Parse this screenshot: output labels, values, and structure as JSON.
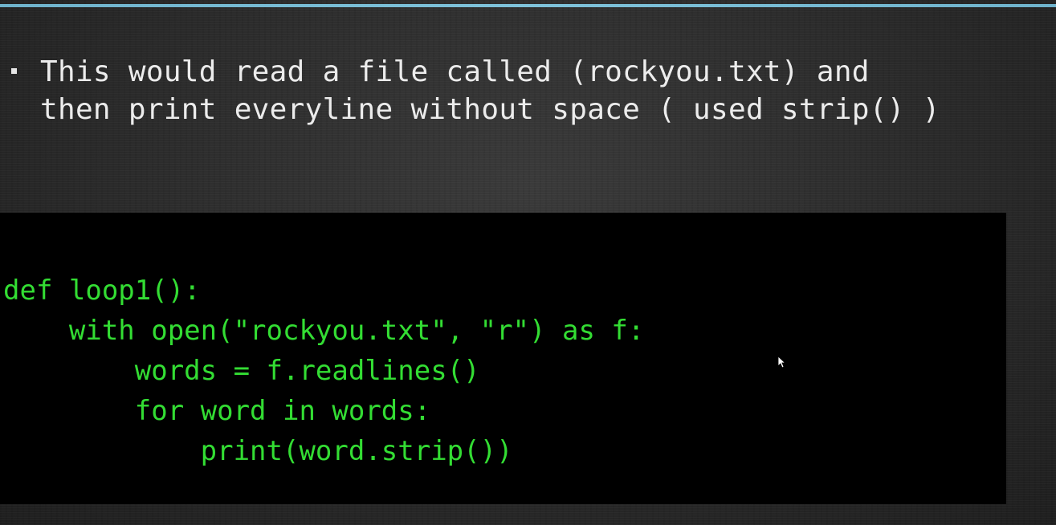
{
  "slide": {
    "bullet_text": "This would read a file called (rockyou.txt) and\nthen print everyline without space ( used strip() )"
  },
  "code": {
    "lines": [
      "def loop1():",
      "    with open(\"rockyou.txt\", \"r\") as f:",
      "        words = f.readlines()",
      "        for word in words:",
      "            print(word.strip())"
    ]
  },
  "colors": {
    "accent_rule": "#7fc3db",
    "code_text": "#33dd33",
    "code_background": "#000000",
    "slide_text": "#ececec"
  },
  "icons": {
    "cursor": "mouse-pointer-icon",
    "bullet": "square-bullet-icon"
  }
}
